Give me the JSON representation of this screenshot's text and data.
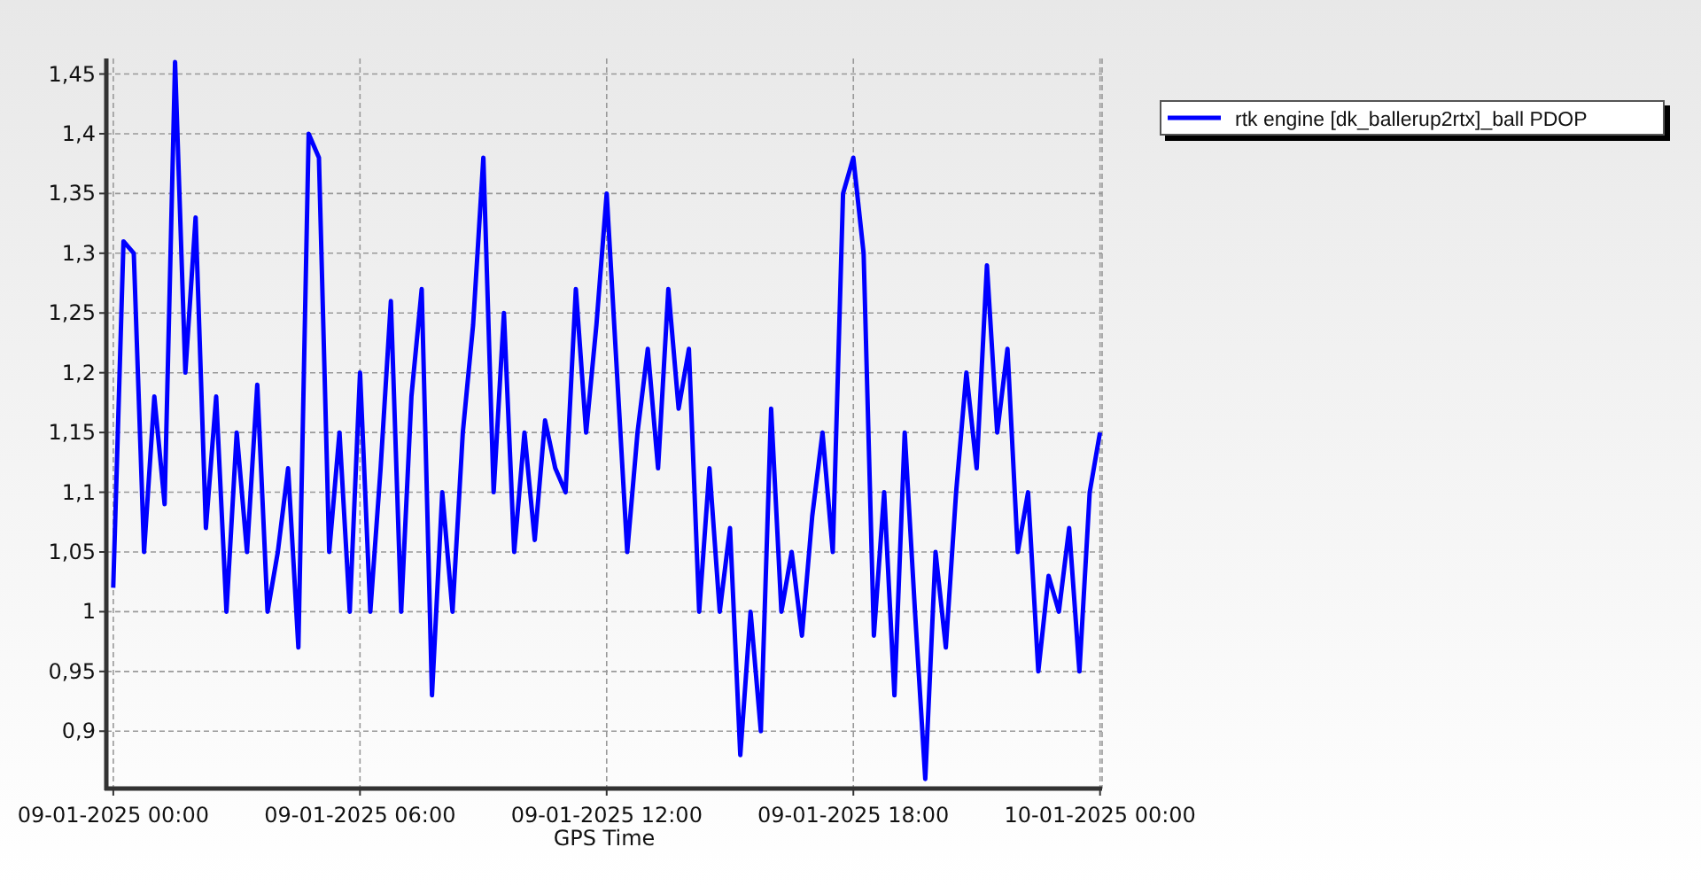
{
  "chart_data": {
    "type": "line",
    "xlabel": "GPS Time",
    "grid": true,
    "ylim": [
      0.852,
      1.463
    ],
    "yticks": [
      {
        "value": 0.9,
        "label": "0,9"
      },
      {
        "value": 0.95,
        "label": "0,95"
      },
      {
        "value": 1,
        "label": "1"
      },
      {
        "value": 1.05,
        "label": "1,05"
      },
      {
        "value": 1.1,
        "label": "1,1"
      },
      {
        "value": 1.15,
        "label": "1,15"
      },
      {
        "value": 1.2,
        "label": "1,2"
      },
      {
        "value": 1.25,
        "label": "1,25"
      },
      {
        "value": 1.3,
        "label": "1,3"
      },
      {
        "value": 1.35,
        "label": "1,35"
      },
      {
        "value": 1.4,
        "label": "1,4"
      },
      {
        "value": 1.45,
        "label": "1,45"
      }
    ],
    "categories": [
      "09-01-2025 00:00",
      null,
      null,
      null,
      null,
      null,
      null,
      null,
      null,
      null,
      null,
      null,
      null,
      null,
      null,
      null,
      null,
      null,
      null,
      null,
      null,
      null,
      null,
      null,
      "09-01-2025 06:00",
      null,
      null,
      null,
      null,
      null,
      null,
      null,
      null,
      null,
      null,
      null,
      null,
      null,
      null,
      null,
      null,
      null,
      null,
      null,
      null,
      null,
      null,
      null,
      "09-01-2025 12:00",
      null,
      null,
      null,
      null,
      null,
      null,
      null,
      null,
      null,
      null,
      null,
      null,
      null,
      null,
      null,
      null,
      null,
      null,
      null,
      null,
      null,
      null,
      null,
      "09-01-2025 18:00",
      null,
      null,
      null,
      null,
      null,
      null,
      null,
      null,
      null,
      null,
      null,
      null,
      null,
      null,
      null,
      null,
      null,
      null,
      null,
      null,
      null,
      null,
      null,
      "10-01-2025 00:00"
    ],
    "series": [
      {
        "name": "rtk engine [dk_ballerup2rtx]_ball PDOP",
        "color": "#0000ff",
        "values": [
          1.02,
          1.31,
          1.3,
          1.05,
          1.18,
          1.09,
          1.46,
          1.2,
          1.33,
          1.07,
          1.18,
          1.0,
          1.15,
          1.05,
          1.19,
          1.0,
          1.05,
          1.12,
          0.97,
          1.4,
          1.38,
          1.05,
          1.15,
          1.0,
          1.2,
          1.0,
          1.12,
          1.26,
          1.0,
          1.18,
          1.27,
          0.93,
          1.1,
          1.0,
          1.15,
          1.24,
          1.38,
          1.1,
          1.25,
          1.05,
          1.15,
          1.06,
          1.16,
          1.12,
          1.1,
          1.27,
          1.15,
          1.24,
          1.35,
          1.2,
          1.05,
          1.15,
          1.22,
          1.12,
          1.27,
          1.17,
          1.22,
          1.0,
          1.12,
          1.0,
          1.07,
          0.88,
          1.0,
          0.9,
          1.17,
          1.0,
          1.05,
          0.98,
          1.08,
          1.15,
          1.05,
          1.35,
          1.38,
          1.3,
          0.98,
          1.1,
          0.93,
          1.15,
          1.0,
          0.86,
          1.05,
          0.97,
          1.1,
          1.2,
          1.12,
          1.29,
          1.15,
          1.22,
          1.05,
          1.1,
          0.95,
          1.03,
          1.0,
          1.07,
          0.95,
          1.1,
          1.15
        ]
      }
    ]
  }
}
